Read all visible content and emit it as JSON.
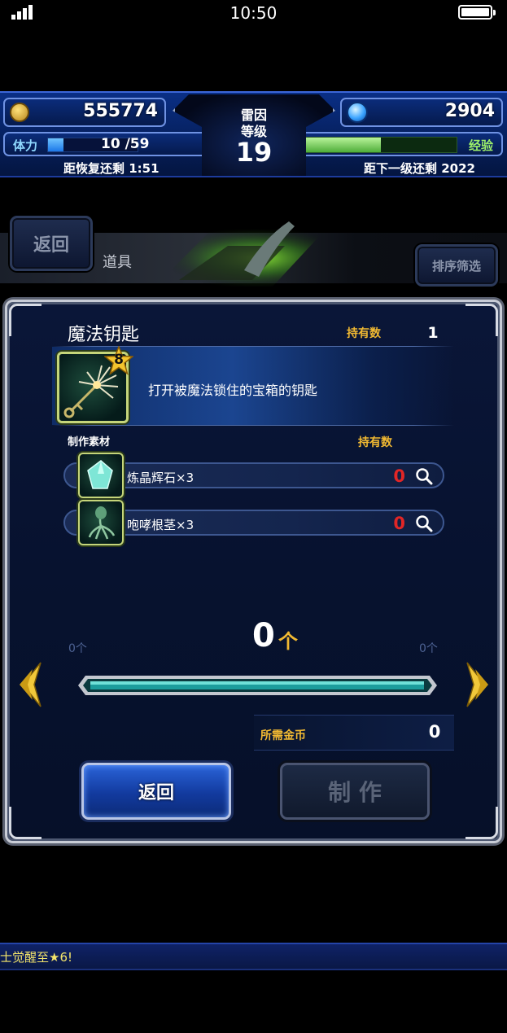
{
  "status_bar": {
    "time": "10:50",
    "battery_level": 1.0
  },
  "header": {
    "gil": "555774",
    "gems": "2904",
    "player_name": "雷因",
    "level_label": "等级",
    "level": "19",
    "stamina_label": "体力",
    "stamina_value": "10 /59",
    "stamina_current": 10,
    "stamina_max": 59,
    "stamina_recovery": "距恢复还剩 1:51",
    "exp_label": "经验",
    "exp_progress": 0.5,
    "next_level": "距下一级还剩 2022"
  },
  "nav": {
    "back_label": "返回",
    "section_title": "道具",
    "sort_filter_label": "排序筛选"
  },
  "item": {
    "name": "魔法钥匙",
    "owned_label": "持有数",
    "owned_count": "1",
    "rarity": "8",
    "description": "打开被魔法锁住的宝箱的钥匙"
  },
  "materials": {
    "header": "制作素材",
    "owned_header": "持有数",
    "list": [
      {
        "name": "炼晶辉石×3",
        "count": "0",
        "icon": "crystal-icon"
      },
      {
        "name": "咆哮根茎×3",
        "count": "0",
        "icon": "root-icon"
      }
    ]
  },
  "quantity": {
    "value": "0",
    "unit": "个",
    "min_label": "0个",
    "max_label": "0个",
    "slider_position": 0
  },
  "cost": {
    "label": "所需金币",
    "value": "0"
  },
  "buttons": {
    "back": "返回",
    "craft": "制 作"
  },
  "ticker": {
    "text": "士觉醒至★6!"
  },
  "colors": {
    "accent_gold": "#f1b932",
    "stamina_bar": "#2a8bff",
    "exp_bar": "#7fd46c",
    "count_red": "#e12626"
  }
}
